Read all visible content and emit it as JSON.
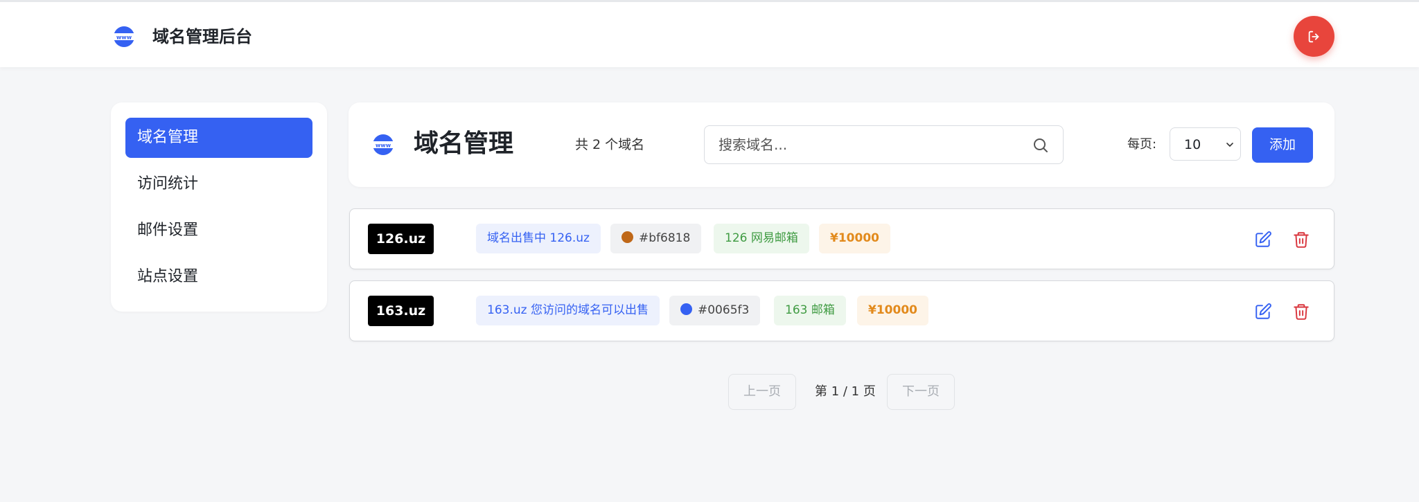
{
  "app": {
    "title": "域名管理后台"
  },
  "sidebar": {
    "items": [
      {
        "label": "域名管理",
        "active": true
      },
      {
        "label": "访问统计"
      },
      {
        "label": "邮件设置"
      },
      {
        "label": "站点设置"
      }
    ]
  },
  "header": {
    "title": "域名管理",
    "count_text": "共 2 个域名",
    "search_placeholder": "搜索域名...",
    "per_page_label": "每页:",
    "per_page_value": "10",
    "add_label": "添加"
  },
  "domains": [
    {
      "name": "126",
      "suffix": ".uz",
      "description": "域名出售中 126.uz",
      "color": "#bf6818",
      "email_label": "126 网易邮箱",
      "price": "¥10000"
    },
    {
      "name": "163",
      "suffix": ".uz",
      "description": "163.uz 您访问的域名可以出售",
      "color": "#0065f3",
      "email_label": "163 邮箱",
      "price": "¥10000"
    }
  ],
  "pagination": {
    "prev_label": "上一页",
    "info": "第 1 / 1 页",
    "next_label": "下一页"
  },
  "colors": {
    "accent": "#3561f2",
    "logout": "#e8453c",
    "delete": "#d9363e"
  },
  "icons": {
    "brand": "www-globe-icon",
    "logout": "logout-icon",
    "search": "search-icon",
    "edit": "edit-icon",
    "delete": "trash-icon"
  }
}
